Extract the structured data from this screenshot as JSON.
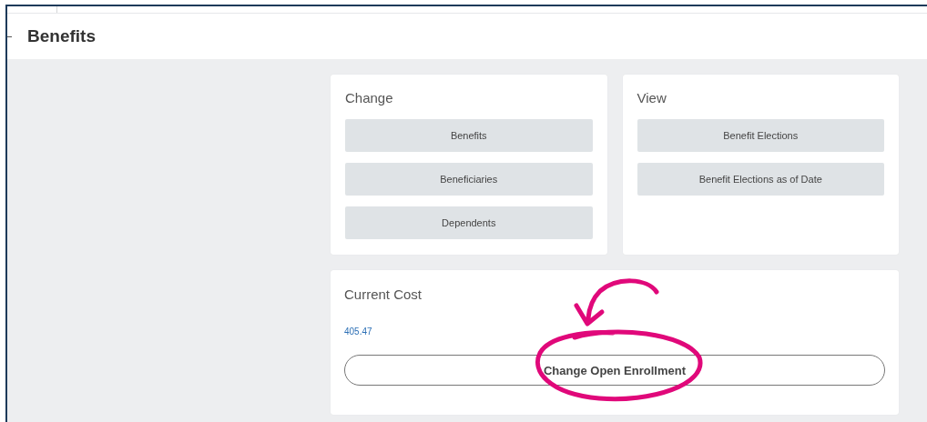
{
  "page": {
    "title": "Benefits"
  },
  "panels": [
    {
      "title": "Change",
      "buttons": [
        "Benefits",
        "Beneficiaries",
        "Dependents"
      ]
    },
    {
      "title": "View",
      "buttons": [
        "Benefit Elections",
        "Benefit Elections as of Date"
      ]
    }
  ],
  "current_cost": {
    "title": "Current Cost",
    "amount": "405.47",
    "button": "Change Open Enrollment"
  }
}
